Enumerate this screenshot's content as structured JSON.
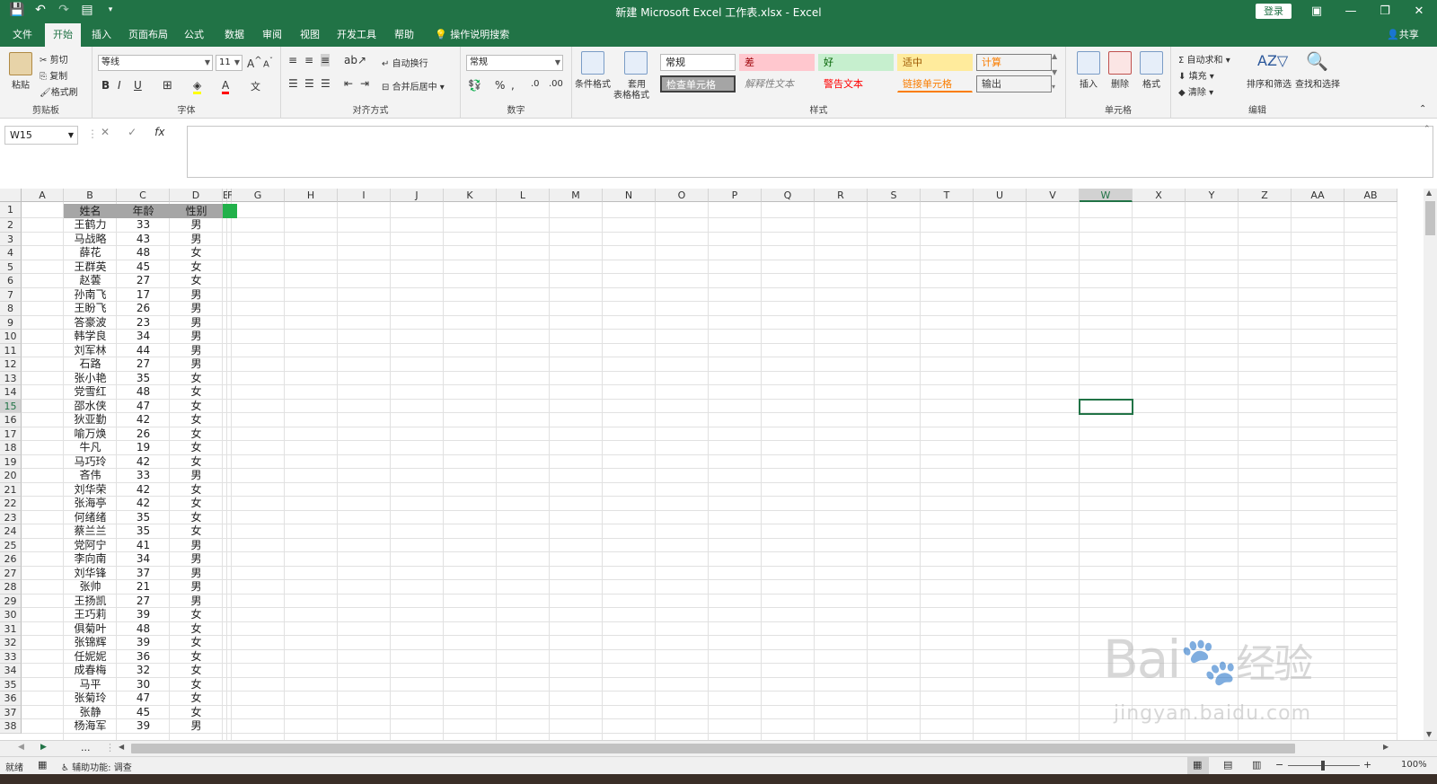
{
  "window": {
    "title": "新建 Microsoft Excel 工作表.xlsx  -  Excel",
    "login": "登录",
    "qat": [
      "save-icon",
      "undo-icon",
      "redo-icon",
      "form-icon",
      "customize-icon"
    ]
  },
  "tabs": [
    "文件",
    "开始",
    "插入",
    "页面布局",
    "公式",
    "数据",
    "审阅",
    "视图",
    "开发工具",
    "帮助"
  ],
  "active_tab": "开始",
  "tellme": "操作说明搜索",
  "share": "共享",
  "ribbon": {
    "clipboard": {
      "label": "剪贴板",
      "paste": "粘贴",
      "cut": "剪切",
      "copy": "复制",
      "format_painter": "格式刷"
    },
    "font": {
      "label": "字体",
      "font_name": "等线",
      "font_size": "11"
    },
    "alignment": {
      "label": "对齐方式",
      "wrap": "自动换行",
      "merge": "合并后居中"
    },
    "number": {
      "label": "数字",
      "format": "常规"
    },
    "styles": {
      "label": "样式",
      "cond_format": "条件格式",
      "table_format_1": "套用",
      "table_format_2": "表格格式",
      "cells": [
        {
          "text": "常规",
          "bg": "#ffffff",
          "fg": "#222222"
        },
        {
          "text": "差",
          "bg": "#ffc7ce",
          "fg": "#9c0006"
        },
        {
          "text": "好",
          "bg": "#c6efce",
          "fg": "#006100"
        },
        {
          "text": "适中",
          "bg": "#ffeb9c",
          "fg": "#9c5700"
        },
        {
          "text": "计算",
          "bg": "#f2f2f2",
          "fg": "#fa7d00"
        },
        {
          "text": "检查单元格",
          "bg": "#a5a5a5",
          "fg": "#ffffff"
        },
        {
          "text": "解释性文本",
          "bg": "#f3f3f3",
          "fg": "#7f7f7f"
        },
        {
          "text": "警告文本",
          "bg": "#f3f3f3",
          "fg": "#ff0000"
        },
        {
          "text": "链接单元格",
          "bg": "#f3f3f3",
          "fg": "#fa7d00"
        },
        {
          "text": "输出",
          "bg": "#f2f2f2",
          "fg": "#3f3f3f"
        }
      ]
    },
    "cells": {
      "label": "单元格",
      "insert": "插入",
      "delete": "删除",
      "format": "格式"
    },
    "editing": {
      "label": "编辑",
      "autosum": "自动求和",
      "fill": "填充",
      "clear": "清除",
      "sort": "排序和筛选",
      "find": "查找和选择"
    }
  },
  "formula_bar": {
    "name_box": "W15",
    "fx": "fx",
    "value": ""
  },
  "columns": [
    "A",
    "B",
    "C",
    "D",
    "E",
    "F",
    "G",
    "H",
    "I",
    "J",
    "K",
    "L",
    "M",
    "N",
    "O",
    "P",
    "Q",
    "R",
    "S",
    "T",
    "U",
    "V",
    "W",
    "X",
    "Y",
    "Z",
    "AA",
    "AB"
  ],
  "selected_column": "W",
  "selected_row": "15",
  "table": {
    "headers": [
      "姓名",
      "年龄",
      "性别"
    ],
    "rows": [
      [
        "王鹤力",
        "33",
        "男"
      ],
      [
        "马战略",
        "43",
        "男"
      ],
      [
        "薛花",
        "48",
        "女"
      ],
      [
        "王群英",
        "45",
        "女"
      ],
      [
        "赵蕓",
        "27",
        "女"
      ],
      [
        "孙南飞",
        "17",
        "男"
      ],
      [
        "王盼飞",
        "26",
        "男"
      ],
      [
        "答豪波",
        "23",
        "男"
      ],
      [
        "韩学良",
        "34",
        "男"
      ],
      [
        "刘军林",
        "44",
        "男"
      ],
      [
        "石路",
        "27",
        "男"
      ],
      [
        "张小艳",
        "35",
        "女"
      ],
      [
        "党雪红",
        "48",
        "女"
      ],
      [
        "邵水侠",
        "47",
        "女"
      ],
      [
        "狄亚勤",
        "42",
        "女"
      ],
      [
        "喻万焕",
        "26",
        "女"
      ],
      [
        "牛凡",
        "19",
        "女"
      ],
      [
        "马巧玲",
        "42",
        "女"
      ],
      [
        "吝伟",
        "33",
        "男"
      ],
      [
        "刘华荣",
        "42",
        "女"
      ],
      [
        "张海亭",
        "42",
        "女"
      ],
      [
        "何绪绪",
        "35",
        "女"
      ],
      [
        "蔡兰兰",
        "35",
        "女"
      ],
      [
        "党阿宁",
        "41",
        "男"
      ],
      [
        "李向南",
        "34",
        "男"
      ],
      [
        "刘华锋",
        "37",
        "男"
      ],
      [
        "张帅",
        "21",
        "男"
      ],
      [
        "王扬凯",
        "27",
        "男"
      ],
      [
        "王巧莉",
        "39",
        "女"
      ],
      [
        "俱菊叶",
        "48",
        "女"
      ],
      [
        "张锦辉",
        "39",
        "女"
      ],
      [
        "任妮妮",
        "36",
        "女"
      ],
      [
        "成春梅",
        "32",
        "女"
      ],
      [
        "马平",
        "30",
        "女"
      ],
      [
        "张菊玲",
        "47",
        "女"
      ],
      [
        "张静",
        "45",
        "女"
      ],
      [
        "杨海军",
        "39",
        "男"
      ]
    ]
  },
  "status": {
    "ready": "就绪",
    "accessibility": "辅助功能: 调查",
    "zoom": "100%",
    "sheet_more": "..."
  },
  "watermark": {
    "text1": "Bai",
    "text2": "经验",
    "url": "jingyan.baidu.com"
  }
}
